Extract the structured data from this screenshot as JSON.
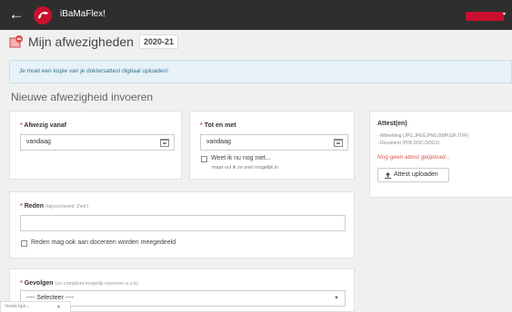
{
  "header": {
    "app_name": "iBaMaFlex!",
    "back_icon": "arrow-left-icon",
    "logo_icon": "ibamaflex-logo",
    "user_caret": "▾",
    "brand_color": "#c8102e"
  },
  "page": {
    "title": "Mijn afwezigheden",
    "year": "2020-21",
    "title_icon": "absence-icon"
  },
  "info": {
    "message": "Je moet een kopie van je doktersattest digitaal uploaden!"
  },
  "form": {
    "section_title": "Nieuwe afwezigheid invoeren",
    "required_mark": "*",
    "from": {
      "label": "Afwezig vanaf",
      "value": "vandaag"
    },
    "to": {
      "label": "Tot en met",
      "value": "vandaag",
      "unknown_label": "Weet ik nu nog niet...",
      "unknown_note": "maar vul ik zo snel mogelijk in"
    },
    "reason": {
      "label": "Reden",
      "hint": "(bijvoorbeeld 'Ziek')",
      "value": "",
      "share_label": "Reden mag ook aan docenten worden meegedeeld"
    },
    "consequences": {
      "label": "Gevolgen",
      "hint": "(zo compleet mogelijk invoeren a.u.b)",
      "selected": "---- Selecteer ----"
    }
  },
  "attest": {
    "title": "Attest(en)",
    "type_image": "- Afbeelding (JPG,JPEG,PNG,BMP,GIF,TIFF)",
    "type_document": "- Document (PDF,DOC,DOCX)",
    "empty": "Nog geen attest geüpload...",
    "upload_label": "Attest uploaden"
  },
  "footer": {
    "tab_label": "Versie kpn...",
    "caret": "▴"
  }
}
